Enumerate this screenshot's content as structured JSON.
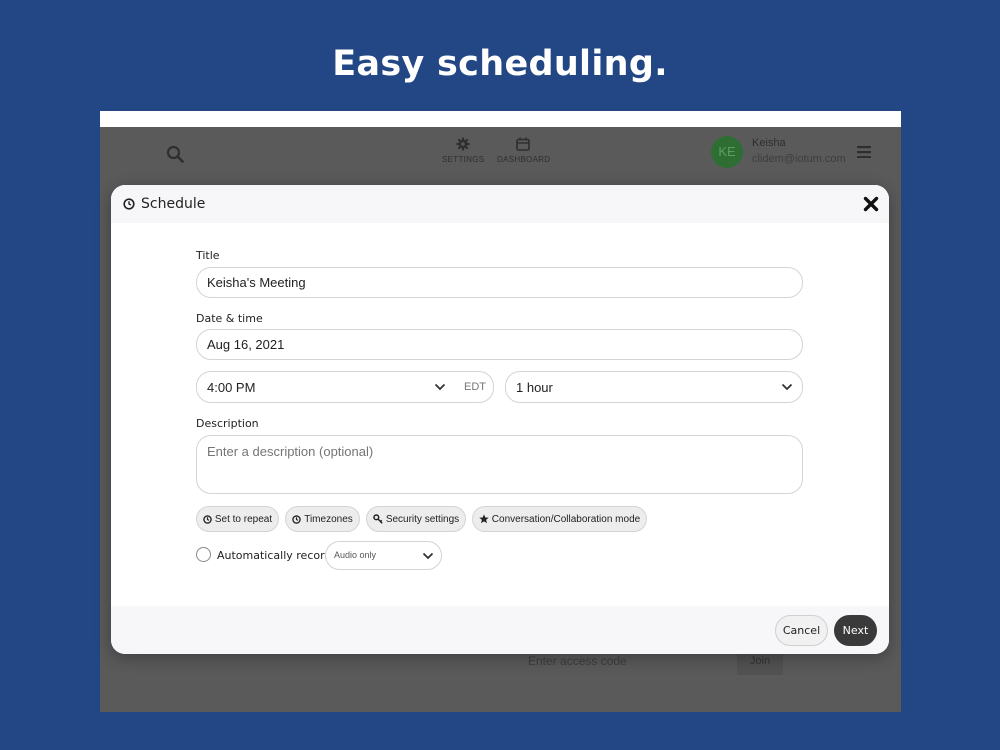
{
  "headline": "Easy scheduling.",
  "background_app": {
    "nav": {
      "settings_label": "SETTINGS",
      "dashboard_label": "DASHBOARD"
    },
    "user": {
      "initials": "KE",
      "name": "Keisha",
      "email": "clidem@iotum.com"
    },
    "access_code_placeholder": "Enter access code",
    "join_label": "Join"
  },
  "modal": {
    "title": "Schedule",
    "title_label": "Title",
    "title_value": "Keisha's Meeting",
    "datetime_label": "Date & time",
    "date_value": "Aug 16, 2021",
    "time_value": "4:00 PM",
    "timezone_abbr": "EDT",
    "duration_value": "1 hour",
    "description_label": "Description",
    "description_placeholder": "Enter a description (optional)",
    "chips": {
      "repeat": "Set to repeat",
      "timezones": "Timezones",
      "security": "Security settings",
      "mode": "Conversation/Collaboration mode"
    },
    "auto_record_label": "Automatically record",
    "record_option": "Audio only",
    "cancel_label": "Cancel",
    "next_label": "Next"
  },
  "colors": {
    "page_background": "#234784",
    "overlay": "#5a5a5a",
    "avatar": "#2f6e33",
    "primary_button": "#3a3a3a"
  }
}
